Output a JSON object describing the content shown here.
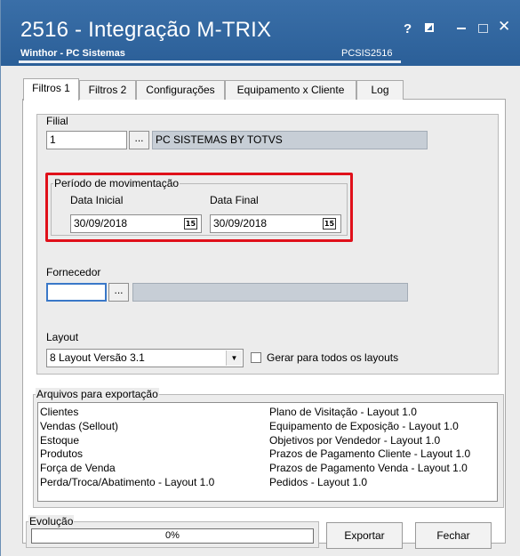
{
  "window": {
    "title": "2516 - Integração M-TRIX",
    "subtitle": "Winthor - PC Sistemas",
    "code": "PCSIS2516",
    "help_glyph": "?",
    "close_glyph": "✕"
  },
  "tabs": [
    {
      "label": "Filtros 1",
      "active": true
    },
    {
      "label": "Filtros 2",
      "active": false
    },
    {
      "label": "Configurações",
      "active": false
    },
    {
      "label": "Equipamento x Cliente",
      "active": false
    },
    {
      "label": "Log",
      "active": false
    }
  ],
  "filial": {
    "label": "Filial",
    "code_value": "1",
    "ellipsis": "...",
    "description": "PC SISTEMAS BY TOTVS"
  },
  "periodo": {
    "legend": "Período de movimentação",
    "data_inicial_label": "Data Inicial",
    "data_inicial_value": "30/09/2018",
    "data_final_label": "Data Final",
    "data_final_value": "30/09/2018",
    "calendar_glyph": "15"
  },
  "fornecedor": {
    "label": "Fornecedor",
    "code_value": "",
    "ellipsis": "...",
    "description": ""
  },
  "layout": {
    "label": "Layout",
    "selected": "8 Layout Versão 3.1",
    "arrow": "▼",
    "checkbox_label": "Gerar para todos os layouts",
    "checkbox_checked": false
  },
  "arquivos": {
    "legend": "Arquivos para exportação",
    "left": [
      "Clientes",
      "Vendas (Sellout)",
      "Estoque",
      "Produtos",
      "Força de Venda",
      "Perda/Troca/Abatimento - Layout 1.0"
    ],
    "right": [
      "Plano de Visitação - Layout 1.0",
      "Equipamento de Exposição - Layout 1.0",
      "Objetivos por Vendedor - Layout 1.0",
      "Prazos de Pagamento Cliente - Layout 1.0",
      "Prazos de Pagamento Venda - Layout 1.0",
      "Pedidos - Layout 1.0"
    ]
  },
  "evolucao": {
    "legend": "Evolução",
    "progress_text": "0%",
    "progress": 0
  },
  "buttons": {
    "exportar": "Exportar",
    "fechar": "Fechar"
  },
  "colors": {
    "titlebar": "#2b5f98",
    "highlight": "#e0101a",
    "disabled_field": "#c7ced6"
  }
}
